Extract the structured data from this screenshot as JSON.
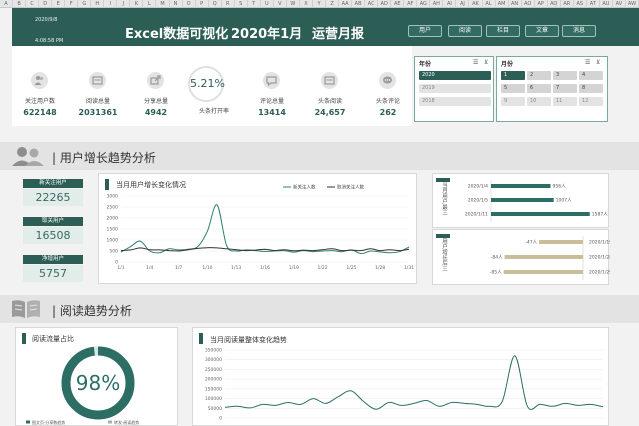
{
  "sheet": {
    "columns": [
      "A",
      "B",
      "C",
      "D",
      "E",
      "F",
      "G",
      "H",
      "I",
      "J",
      "K",
      "L",
      "M",
      "N",
      "O",
      "P",
      "Q",
      "R",
      "S",
      "T",
      "U",
      "V",
      "W",
      "X",
      "Y",
      "Z",
      "AA",
      "AB",
      "AC",
      "AD",
      "AE",
      "AF",
      "AG",
      "AH",
      "AI",
      "AJ",
      "AK",
      "AL",
      "AM",
      "AN",
      "AO",
      "AP",
      "AQ",
      "AR",
      "AS",
      "AT",
      "AU",
      "AV",
      "AW"
    ]
  },
  "banner": {
    "date": "2020/9/8",
    "time": "4:08:58 PM",
    "title_main": "Excel数据可视化",
    "title_month": "2020年1月",
    "title_report": "运营月报",
    "nav": [
      "用户",
      "阅读",
      "栏目",
      "文章",
      "消息"
    ]
  },
  "kpis": [
    {
      "label": "关注用户数",
      "value": "622148",
      "icon": "users-icon"
    },
    {
      "label": "阅读总量",
      "value": "2031361",
      "icon": "reading-card-icon"
    },
    {
      "label": "分享总量",
      "value": "4942",
      "icon": "share-icon"
    },
    {
      "label": "头条打开率",
      "value": "5.21%",
      "icon": "open-rate-ring"
    },
    {
      "label": "评论总量",
      "value": "13414",
      "icon": "comment-icon"
    },
    {
      "label": "头条阅读",
      "value": "24,657",
      "icon": "reading-card-icon"
    },
    {
      "label": "头条评论",
      "value": "262",
      "icon": "chat-bubble-icon"
    }
  ],
  "slicer_year": {
    "title": "年份",
    "items": [
      "2020",
      "2019",
      "2018"
    ],
    "selected": "2020"
  },
  "slicer_month": {
    "title": "月份",
    "items": [
      "1",
      "2",
      "3",
      "4",
      "5",
      "6",
      "7",
      "8",
      "9",
      "10",
      "11",
      "12"
    ],
    "selected": "1"
  },
  "section_users": {
    "title": "| 用户增长趋势分析"
  },
  "section_reading": {
    "title": "| 阅读趋势分析"
  },
  "metrics": [
    {
      "label": "新关注用户",
      "value": "22265"
    },
    {
      "label": "取关用户",
      "value": "16508"
    },
    {
      "label": "净增用户",
      "value": "5757"
    }
  ],
  "user_chart": {
    "title": "当月用户增长变化情况",
    "legend": [
      "新关注人数",
      "取消关注人数"
    ],
    "colors": {
      "new": "#2e7d72",
      "cancel": "#333333"
    }
  },
  "top_chart": {
    "side_label": "当月用户最三",
    "color": "#2c6e63"
  },
  "bottom_chart": {
    "side_label": "用户增长后三",
    "color": "#c8bf9a"
  },
  "read_ratio": {
    "title": "阅读流量占比",
    "value": "98%",
    "percent": 98,
    "legend": [
      "图文页·分享数趋势",
      "转发·阅读趋势"
    ]
  },
  "read_chart": {
    "title": "当月阅读量整体变化趋势"
  },
  "chart_data": [
    {
      "type": "line",
      "title": "当月用户增长变化情况",
      "x": [
        "1/1",
        "1/4",
        "1/7",
        "1/10",
        "1/13",
        "1/16",
        "1/19",
        "1/22",
        "1/25",
        "1/28",
        "1/31"
      ],
      "ylim": [
        0,
        3000
      ],
      "yticks": [
        "0",
        "500",
        "1000",
        "1500",
        "2000",
        "2500",
        "3000"
      ],
      "series": [
        {
          "name": "新关注人数",
          "values": [
            450,
            700,
            950,
            500,
            420,
            600,
            550,
            580,
            700,
            1400,
            2600,
            750,
            500,
            550,
            520,
            480,
            500,
            520,
            450,
            520,
            470,
            500,
            520,
            470,
            550,
            380,
            500,
            460,
            420,
            470,
            680
          ]
        },
        {
          "name": "取消关注人数",
          "values": [
            520,
            550,
            640,
            560,
            550,
            520,
            500,
            560,
            620,
            650,
            640,
            600,
            560,
            520,
            540,
            580,
            520,
            560,
            510,
            540,
            520,
            560,
            600,
            520,
            540,
            520,
            600,
            520,
            560,
            520,
            580
          ]
        }
      ]
    },
    {
      "type": "bar",
      "title": "当月用户最三",
      "categories": [
        "2020/1/4",
        "2020/1/5",
        "2020/1/11"
      ],
      "values": [
        956,
        1007,
        1587
      ],
      "value_labels": [
        "956人",
        "1007人",
        "1587人"
      ],
      "xlim": [
        0,
        1800
      ]
    },
    {
      "type": "bar",
      "title": "用户增长后三",
      "categories": [
        "2020/1/19",
        "2020/1/28",
        "2020/1/29"
      ],
      "values": [
        -47,
        -84,
        -85
      ],
      "value_labels": [
        "-47人",
        "-84人",
        "-85人"
      ],
      "xlim": [
        -90,
        0
      ]
    },
    {
      "type": "pie",
      "title": "阅读流量占比",
      "slices": [
        {
          "name": "图文页·分享数趋势",
          "value": 98
        },
        {
          "name": "转发·阅读趋势",
          "value": 2
        }
      ]
    },
    {
      "type": "line",
      "title": "当月阅读量整体变化趋势",
      "ylim": [
        0,
        350000
      ],
      "yticks": [
        "0",
        "50000",
        "100000",
        "150000",
        "200000",
        "250000",
        "300000",
        "350000"
      ],
      "series": [
        {
          "name": "阅读量",
          "values": [
            55000,
            60000,
            52000,
            70000,
            65000,
            80000,
            70000,
            100000,
            75000,
            110000,
            140000,
            85000,
            45000,
            80000,
            65000,
            75000,
            90000,
            60000,
            80000,
            75000,
            70000,
            60000,
            85000,
            320000,
            60000,
            70000,
            60000,
            75000,
            65000,
            70000,
            58000
          ]
        }
      ]
    }
  ]
}
